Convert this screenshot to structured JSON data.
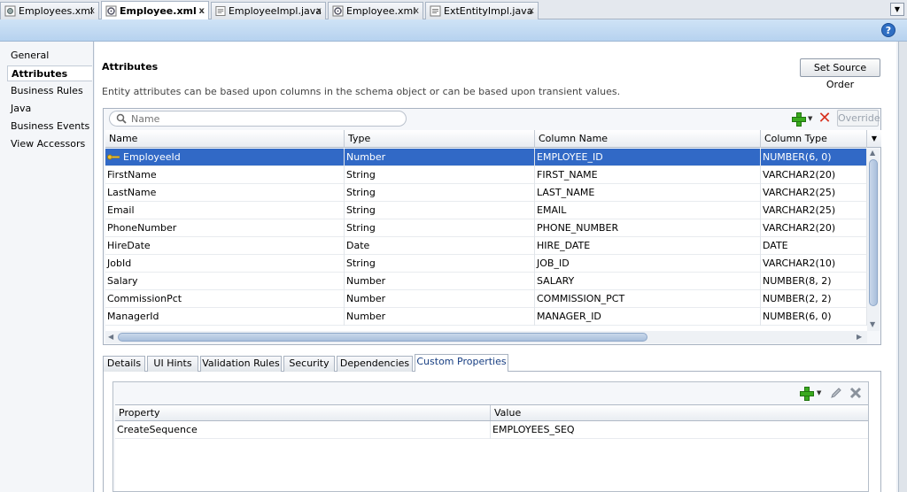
{
  "editor_tabs": [
    {
      "label": "Employees.xml",
      "icon": "xml-file-icon",
      "active": false
    },
    {
      "label": "Employee.xml",
      "icon": "entity-file-icon",
      "active": true
    },
    {
      "label": "EmployeeImpl.java",
      "icon": "java-file-icon",
      "active": false
    },
    {
      "label": "Employee.xml",
      "icon": "entity-file-icon",
      "active": false
    },
    {
      "label": "ExtEntityImpl.java",
      "icon": "java-file-icon",
      "active": false
    }
  ],
  "tab_close": "x",
  "help": "?",
  "nav": {
    "items": [
      "General",
      "Attributes",
      "Business Rules",
      "Java",
      "Business Events",
      "View Accessors"
    ],
    "selected": "Attributes"
  },
  "main": {
    "title": "Attributes",
    "description": "Entity attributes can be based upon columns in the schema object or can be based upon transient values.",
    "set_source_order": "Set Source Order",
    "search_placeholder": "Name",
    "override": "Override"
  },
  "attributes_table": {
    "columns": [
      "Name",
      "Type",
      "Column Name",
      "Column Type"
    ],
    "rows": [
      [
        "EmployeeId",
        "Number",
        "EMPLOYEE_ID",
        "NUMBER(6, 0)"
      ],
      [
        "FirstName",
        "String",
        "FIRST_NAME",
        "VARCHAR2(20)"
      ],
      [
        "LastName",
        "String",
        "LAST_NAME",
        "VARCHAR2(25)"
      ],
      [
        "Email",
        "String",
        "EMAIL",
        "VARCHAR2(25)"
      ],
      [
        "PhoneNumber",
        "String",
        "PHONE_NUMBER",
        "VARCHAR2(20)"
      ],
      [
        "HireDate",
        "Date",
        "HIRE_DATE",
        "DATE"
      ],
      [
        "JobId",
        "String",
        "JOB_ID",
        "VARCHAR2(10)"
      ],
      [
        "Salary",
        "Number",
        "SALARY",
        "NUMBER(8, 2)"
      ],
      [
        "CommissionPct",
        "Number",
        "COMMISSION_PCT",
        "NUMBER(2, 2)"
      ],
      [
        "ManagerId",
        "Number",
        "MANAGER_ID",
        "NUMBER(6, 0)"
      ]
    ],
    "selected_row": 0
  },
  "sub_tabs": {
    "items": [
      "Details",
      "UI Hints",
      "Validation Rules",
      "Security",
      "Dependencies",
      "Custom Properties"
    ],
    "active": "Custom Properties"
  },
  "custom_properties": {
    "columns": [
      "Property",
      "Value"
    ],
    "rows": [
      [
        "CreateSequence",
        "EMPLOYEES_SEQ"
      ]
    ]
  },
  "colors": {
    "selection": "#3169c6",
    "band": "#c3dbf3",
    "add": "#3aaa1e",
    "delete": "#d8321f"
  }
}
